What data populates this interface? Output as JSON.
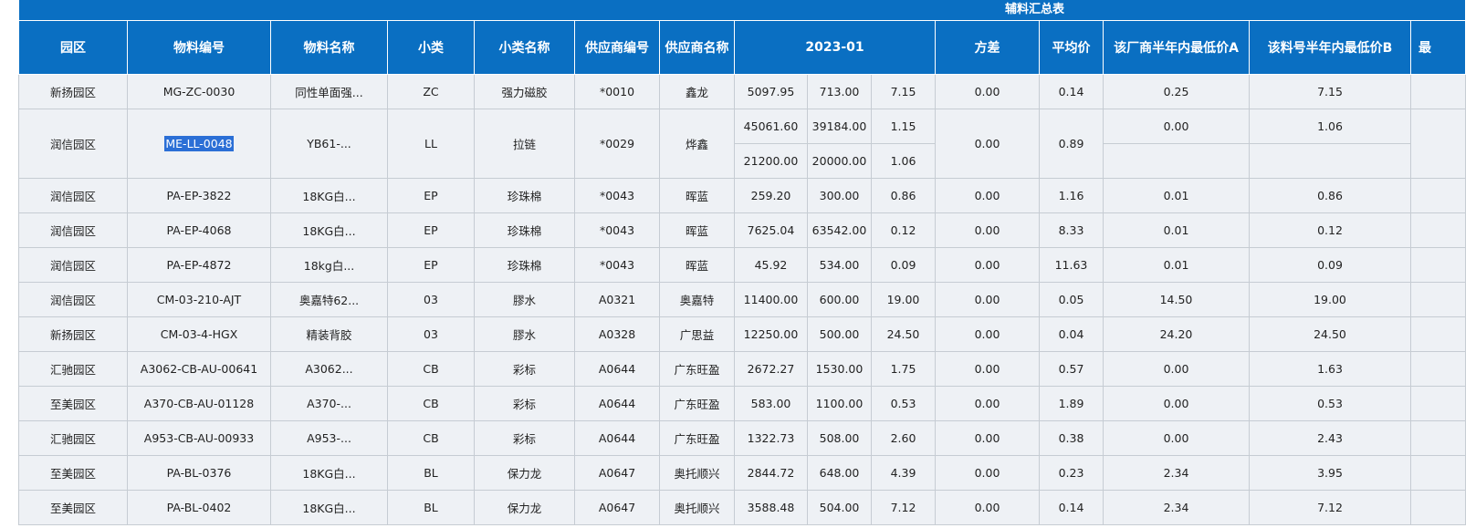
{
  "report_title": "辅料汇总表",
  "headers": [
    "园区",
    "物料编号",
    "物料名称",
    "小类",
    "小类名称",
    "供应商编号",
    "供应商名称",
    "2023-01",
    "方差",
    "平均价",
    "该厂商半年内最低价A",
    "该料号半年内最低价B",
    "最"
  ],
  "selected_text": "ME-LL-0048",
  "rows": [
    {
      "park": "新扬园区",
      "code": "MG-ZC-0030",
      "name": "同性单面强...",
      "cat": "ZC",
      "cat_name": "强力磁胶",
      "supplier_no": "*0010",
      "supplier_name": "鑫龙",
      "amount": "5097.95",
      "qty": "713.00",
      "price": "7.15",
      "variance": "0.00",
      "avg": "0.14",
      "lowA": "0.25",
      "lowB": "7.15"
    },
    {
      "park": "润信园区",
      "code": "ME-LL-0048",
      "name": "YB61-...",
      "cat": "LL",
      "cat_name": "拉链",
      "supplier_no": "*0029",
      "supplier_name": "烨鑫",
      "amount": "45061.60",
      "qty": "39184.00",
      "price": "1.15",
      "variance": "0.00",
      "avg": "0.89",
      "lowA": "0.00",
      "lowB": "1.06",
      "sub": {
        "amount": "21200.00",
        "qty": "20000.00",
        "price": "1.06",
        "lowA": "",
        "lowB": ""
      }
    },
    {
      "park": "润信园区",
      "code": "PA-EP-3822",
      "name": "18KG白...",
      "cat": "EP",
      "cat_name": "珍珠棉",
      "supplier_no": "*0043",
      "supplier_name": "晖蓝",
      "amount": "259.20",
      "qty": "300.00",
      "price": "0.86",
      "variance": "0.00",
      "avg": "1.16",
      "lowA": "0.01",
      "lowB": "0.86"
    },
    {
      "park": "润信园区",
      "code": "PA-EP-4068",
      "name": "18KG白...",
      "cat": "EP",
      "cat_name": "珍珠棉",
      "supplier_no": "*0043",
      "supplier_name": "晖蓝",
      "amount": "7625.04",
      "qty": "63542.00",
      "price": "0.12",
      "variance": "0.00",
      "avg": "8.33",
      "lowA": "0.01",
      "lowB": "0.12"
    },
    {
      "park": "润信园区",
      "code": "PA-EP-4872",
      "name": "18kg白...",
      "cat": "EP",
      "cat_name": "珍珠棉",
      "supplier_no": "*0043",
      "supplier_name": "晖蓝",
      "amount": "45.92",
      "qty": "534.00",
      "price": "0.09",
      "variance": "0.00",
      "avg": "11.63",
      "lowA": "0.01",
      "lowB": "0.09"
    },
    {
      "park": "润信园区",
      "code": "CM-03-210-AJT",
      "name": "奥嘉特62...",
      "cat": "03",
      "cat_name": "膠水",
      "supplier_no": "A0321",
      "supplier_name": "奥嘉特",
      "amount": "11400.00",
      "qty": "600.00",
      "price": "19.00",
      "variance": "0.00",
      "avg": "0.05",
      "lowA": "14.50",
      "lowB": "19.00"
    },
    {
      "park": "新扬园区",
      "code": "CM-03-4-HGX",
      "name": "精装背胶",
      "cat": "03",
      "cat_name": "膠水",
      "supplier_no": "A0328",
      "supplier_name": "广思益",
      "amount": "12250.00",
      "qty": "500.00",
      "price": "24.50",
      "variance": "0.00",
      "avg": "0.04",
      "lowA": "24.20",
      "lowB": "24.50"
    },
    {
      "park": "汇驰园区",
      "code": "A3062-CB-AU-00641",
      "name": "A3062...",
      "cat": "CB",
      "cat_name": "彩标",
      "supplier_no": "A0644",
      "supplier_name": "广东旺盈",
      "amount": "2672.27",
      "qty": "1530.00",
      "price": "1.75",
      "variance": "0.00",
      "avg": "0.57",
      "lowA": "0.00",
      "lowB": "1.63"
    },
    {
      "park": "至美园区",
      "code": "A370-CB-AU-01128",
      "name": "A370-...",
      "cat": "CB",
      "cat_name": "彩标",
      "supplier_no": "A0644",
      "supplier_name": "广东旺盈",
      "amount": "583.00",
      "qty": "1100.00",
      "price": "0.53",
      "variance": "0.00",
      "avg": "1.89",
      "lowA": "0.00",
      "lowB": "0.53"
    },
    {
      "park": "汇驰园区",
      "code": "A953-CB-AU-00933",
      "name": "A953-...",
      "cat": "CB",
      "cat_name": "彩标",
      "supplier_no": "A0644",
      "supplier_name": "广东旺盈",
      "amount": "1322.73",
      "qty": "508.00",
      "price": "2.60",
      "variance": "0.00",
      "avg": "0.38",
      "lowA": "0.00",
      "lowB": "2.43"
    },
    {
      "park": "至美园区",
      "code": "PA-BL-0376",
      "name": "18KG白...",
      "cat": "BL",
      "cat_name": "保力龙",
      "supplier_no": "A0647",
      "supplier_name": "奥托顺兴",
      "amount": "2844.72",
      "qty": "648.00",
      "price": "4.39",
      "variance": "0.00",
      "avg": "0.23",
      "lowA": "2.34",
      "lowB": "3.95"
    },
    {
      "park": "至美园区",
      "code": "PA-BL-0402",
      "name": "18KG白...",
      "cat": "BL",
      "cat_name": "保力龙",
      "supplier_no": "A0647",
      "supplier_name": "奥托顺兴",
      "amount": "3588.48",
      "qty": "504.00",
      "price": "7.12",
      "variance": "0.00",
      "avg": "0.14",
      "lowA": "2.34",
      "lowB": "7.12"
    }
  ]
}
